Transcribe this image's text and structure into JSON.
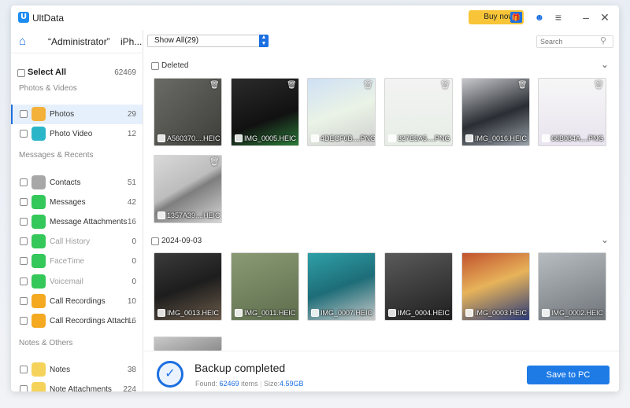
{
  "app": {
    "name": "UltData",
    "buy_now": "Buy now"
  },
  "nav": {
    "owner": "“Administrator”",
    "device": "iPh..."
  },
  "sidebar": {
    "select_all": {
      "label": "Select All",
      "count": "62469"
    },
    "sections": [
      "Photos & Videos",
      "Messages & Recents",
      "Notes & Others"
    ],
    "items": [
      {
        "label": "Photos",
        "count": "29",
        "icon": "photos-icon",
        "color": "#f3b13a"
      },
      {
        "label": "Photo Video",
        "count": "12",
        "icon": "video-icon",
        "color": "#2bb5c9"
      },
      {
        "label": "Contacts",
        "count": "51",
        "icon": "contacts-icon",
        "color": "#a7a7a7"
      },
      {
        "label": "Messages",
        "count": "42",
        "icon": "messages-icon",
        "color": "#34c759"
      },
      {
        "label": "Message Attachments",
        "count": "16",
        "icon": "message-attachments-icon",
        "color": "#34c759"
      },
      {
        "label": "Call History",
        "count": "0",
        "icon": "phone-icon",
        "color": "#34c759"
      },
      {
        "label": "FaceTime",
        "count": "0",
        "icon": "facetime-icon",
        "color": "#34c759"
      },
      {
        "label": "Voicemail",
        "count": "0",
        "icon": "voicemail-icon",
        "color": "#34c759"
      },
      {
        "label": "Call Recordings",
        "count": "10",
        "icon": "call-recordings-icon",
        "color": "#f4a921"
      },
      {
        "label": "Call Recordings Attach...",
        "count": "16",
        "icon": "call-recordings-attach-icon",
        "color": "#f4a921"
      },
      {
        "label": "Notes",
        "count": "38",
        "icon": "notes-icon",
        "color": "#f5d35b"
      },
      {
        "label": "Note Attachments",
        "count": "224",
        "icon": "note-attachments-icon",
        "color": "#f5d35b"
      }
    ]
  },
  "toolbar": {
    "filter": "Show All(29)",
    "search_placeholder": "Search"
  },
  "groups": [
    {
      "label": "Deleted",
      "files": [
        "A560370....HEIC",
        "IMG_0005.HEIC",
        "4DECF6B....PNG",
        "327E5A5....PNG",
        "IMG_0016.HEIC",
        "68B084A....PNG",
        "1357A39....HEIC"
      ]
    },
    {
      "label": "2024-09-03",
      "files": [
        "IMG_0013.HEIC",
        "IMG_0011.HEIC",
        "IMG_0007.HEIC",
        "IMG_0004.HEIC",
        "IMG_0003.HEIC",
        "IMG_0002.HEIC"
      ]
    }
  ],
  "footer": {
    "title": "Backup completed",
    "found_label": "Found:",
    "found_count": "62469",
    "items_label": "items",
    "size_label": "Size:",
    "size_value": "4.59GB",
    "save": "Save to PC"
  },
  "colors": {
    "accent": "#1c6fe0",
    "buy": "#f7c537"
  }
}
